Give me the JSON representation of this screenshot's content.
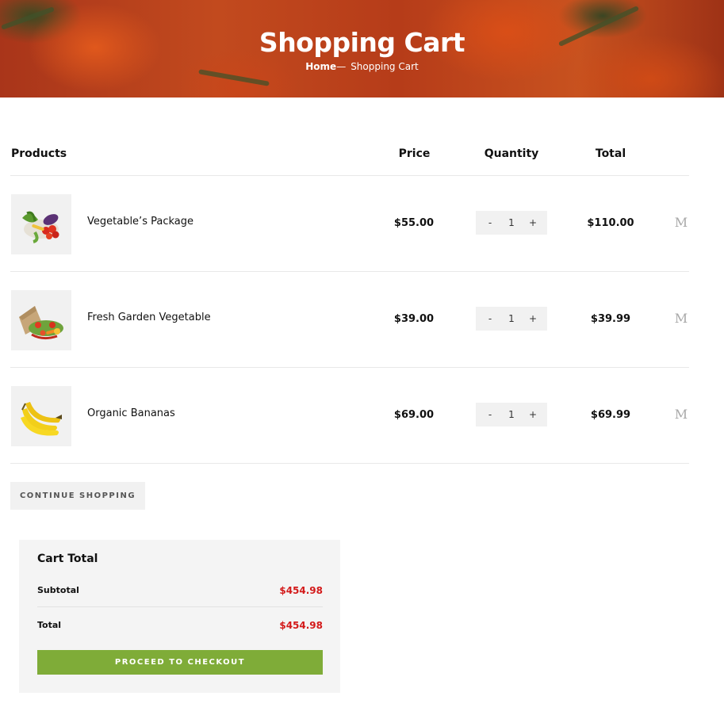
{
  "hero": {
    "title": "Shopping Cart",
    "breadcrumb_home": "Home",
    "breadcrumb_separator": "—",
    "breadcrumb_current": "Shopping Cart"
  },
  "table": {
    "headers": {
      "products": "Products",
      "price": "Price",
      "quantity": "Quantity",
      "total": "Total"
    },
    "rows": [
      {
        "image": "vegetable-package-image",
        "name": "Vegetable’s Package",
        "price": "$55.00",
        "qty": "1",
        "qty_minus": "-",
        "qty_plus": "+",
        "total": "$110.00",
        "remove_icon": "M"
      },
      {
        "image": "garden-vegetable-bag-image",
        "name": "Fresh Garden Vegetable",
        "price": "$39.00",
        "qty": "1",
        "qty_minus": "-",
        "qty_plus": "+",
        "total": "$39.99",
        "remove_icon": "M"
      },
      {
        "image": "bananas-image",
        "name": "Organic Bananas",
        "price": "$69.00",
        "qty": "1",
        "qty_minus": "-",
        "qty_plus": "+",
        "total": "$69.99",
        "remove_icon": "M"
      }
    ]
  },
  "continue_label": "CONTINUE SHOPPING",
  "cart_total": {
    "title": "Cart Total",
    "subtotal_label": "Subtotal",
    "subtotal_value": "$454.98",
    "total_label": "Total",
    "total_value": "$454.98",
    "checkout_label": "PROCEED TO CHECKOUT"
  },
  "colors": {
    "accent_green": "#7fac38",
    "price_red": "#d31a1a",
    "hero_orange": "#c24a1e"
  }
}
